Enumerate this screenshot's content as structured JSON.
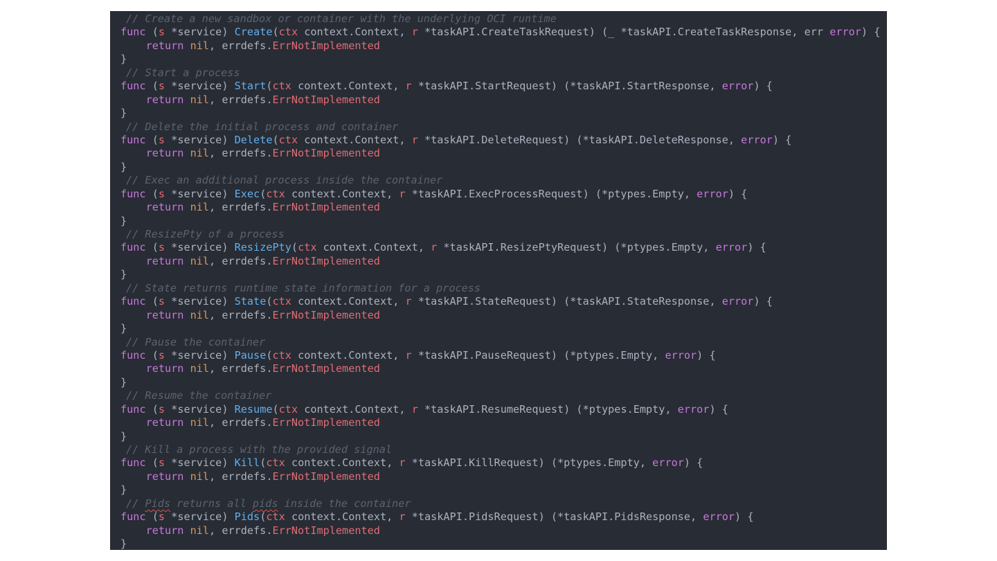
{
  "colors": {
    "background": "#282c34",
    "keyword": "#c678dd",
    "function": "#61afef",
    "parameter": "#e06c75",
    "nil": "#d19a66",
    "error_value": "#e06c75",
    "comment": "#5c6370",
    "text": "#abb2bf"
  },
  "code": {
    "blocks": [
      {
        "comment": "// Create a new sandbox or container with the underlying OCI runtime",
        "name": "Create",
        "args": " context.Context, ",
        "arg2": " *taskAPI.CreateTaskRequest) (_ *taskAPI.CreateTaskResponse, err ",
        "ret": ") {"
      },
      {
        "comment": "// Start a process",
        "name": "Start",
        "args": " context.Context, ",
        "arg2": " *taskAPI.StartRequest) (*taskAPI.StartResponse, ",
        "ret": ") {"
      },
      {
        "comment": "// Delete the initial process and container",
        "name": "Delete",
        "args": " context.Context, ",
        "arg2": " *taskAPI.DeleteRequest) (*taskAPI.DeleteResponse, ",
        "ret": ") {"
      },
      {
        "comment": "// Exec an additional process inside the container",
        "name": "Exec",
        "args": " context.Context, ",
        "arg2": " *taskAPI.ExecProcessRequest) (*ptypes.Empty, ",
        "ret": ") {"
      },
      {
        "comment": "// ResizePty of a process",
        "name": "ResizePty",
        "args": " context.Context, ",
        "arg2": " *taskAPI.ResizePtyRequest) (*ptypes.Empty, ",
        "ret": ") {"
      },
      {
        "comment": "// State returns runtime state information for a process",
        "name": "State",
        "args": " context.Context, ",
        "arg2": " *taskAPI.StateRequest) (*taskAPI.StateResponse, ",
        "ret": ") {"
      },
      {
        "comment": "// Pause the container",
        "name": "Pause",
        "args": " context.Context, ",
        "arg2": " *taskAPI.PauseRequest) (*ptypes.Empty, ",
        "ret": ") {"
      },
      {
        "comment": "// Resume the container",
        "name": "Resume",
        "args": " context.Context, ",
        "arg2": " *taskAPI.ResumeRequest) (*ptypes.Empty, ",
        "ret": ") {"
      },
      {
        "comment": "// Kill a process with the provided signal",
        "name": "Kill",
        "args": " context.Context, ",
        "arg2": " *taskAPI.KillRequest) (*ptypes.Empty, ",
        "ret": ") {"
      },
      {
        "comment_pre": "// ",
        "comment_typo": "Pids",
        "comment_mid": " returns all ",
        "comment_typo2": "pids",
        "comment_post": " inside the container",
        "name": "Pids",
        "args": " context.Context, ",
        "arg2": " *taskAPI.PidsRequest) (*taskAPI.PidsResponse, ",
        "ret": ") {"
      }
    ],
    "tokens": {
      "func": "func",
      "open": " (",
      "recv": "s",
      "recv_type": " *service) ",
      "paren": "(",
      "ctx": "ctx",
      "r": "r",
      "error": "error",
      "indent": "    ",
      "return": "return",
      "nil": " nil",
      "comma": ", errdefs.",
      "errname": "ErrNotImplemented",
      "close": "}"
    }
  }
}
